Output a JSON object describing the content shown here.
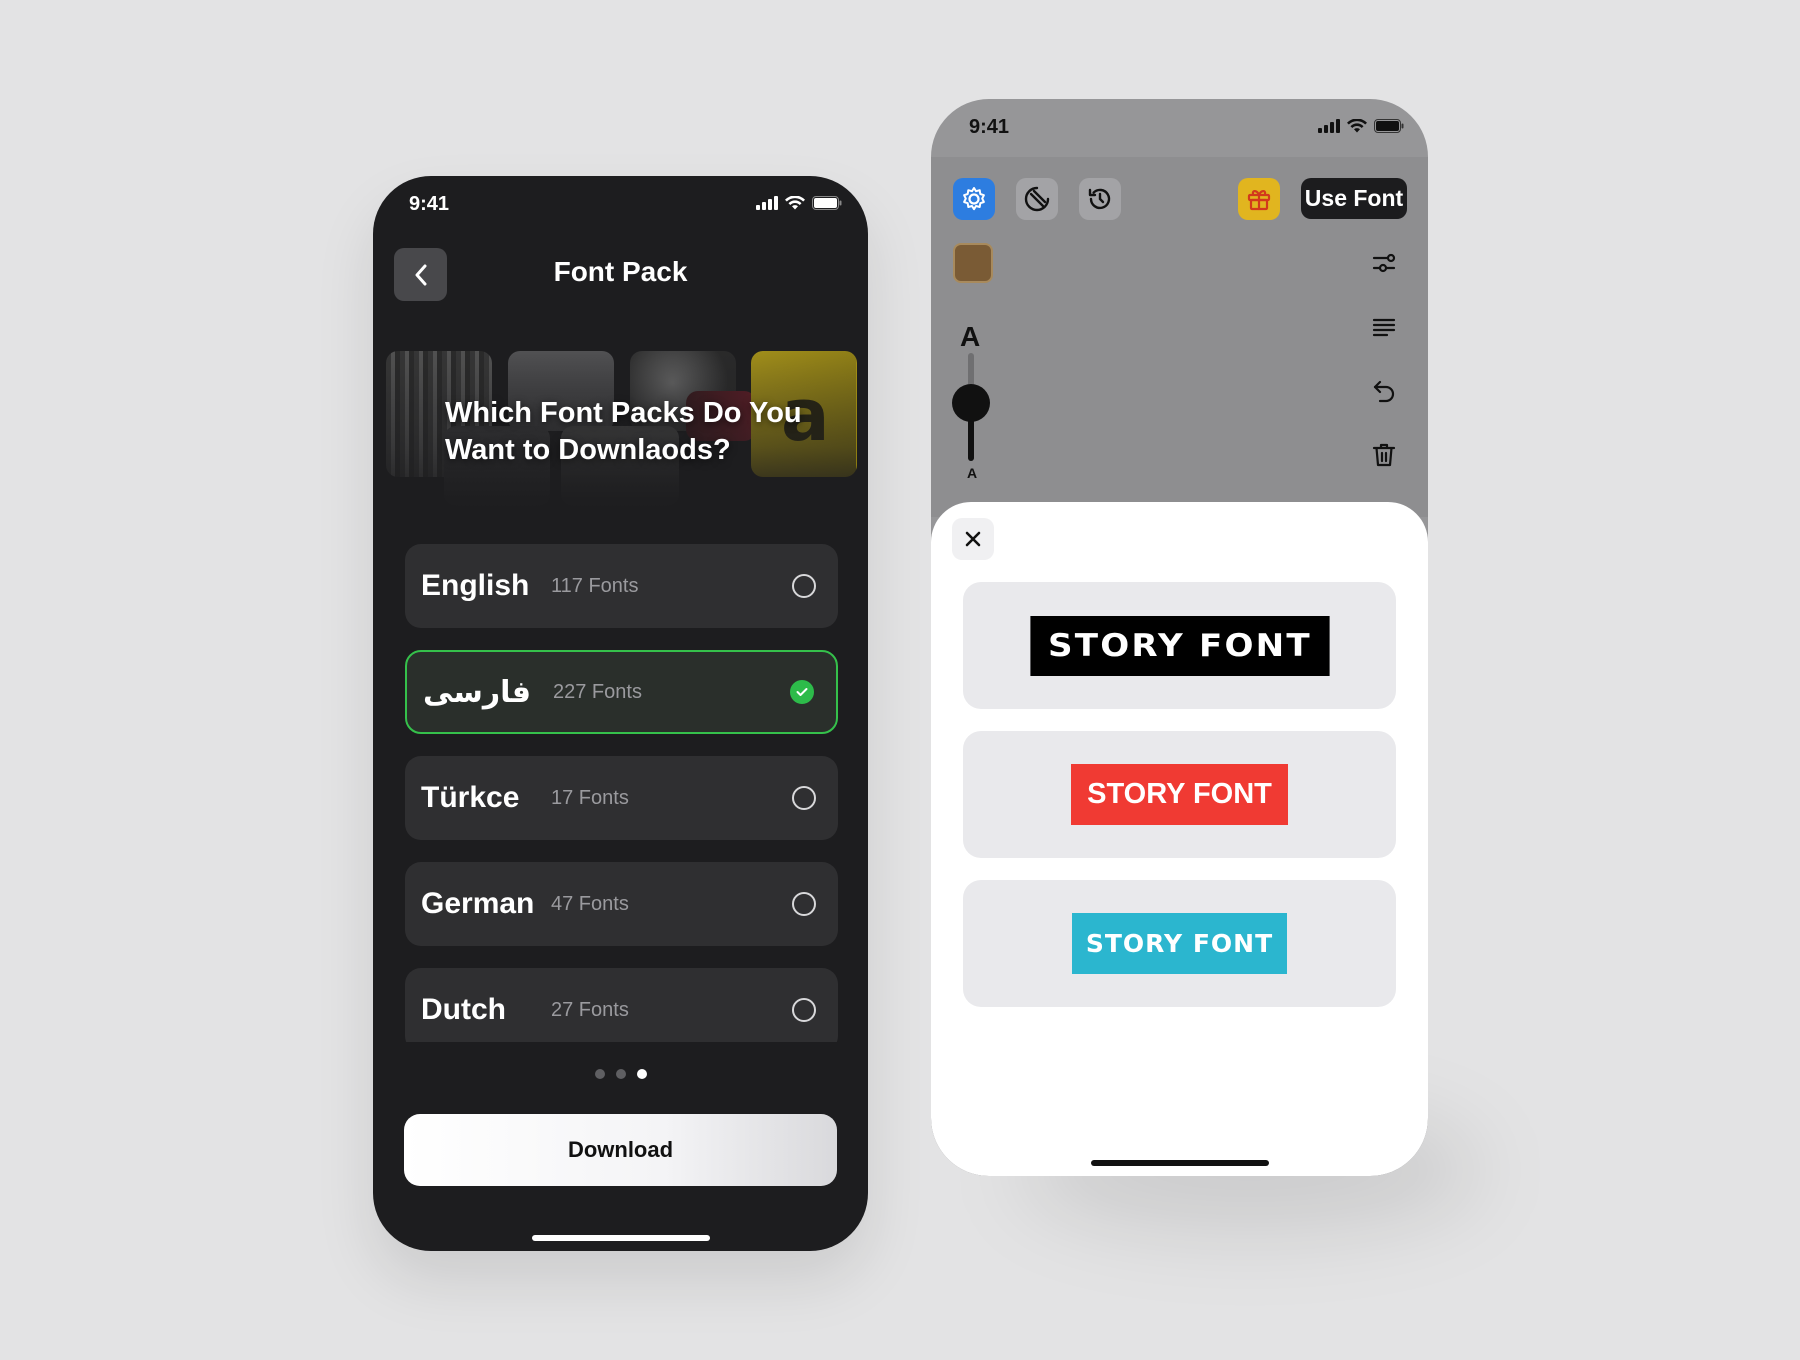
{
  "left_phone": {
    "status": {
      "time": "9:41"
    },
    "nav": {
      "title": "Font Pack"
    },
    "hero": {
      "title": "Which Font Packs Do You Want to Downlaods?",
      "thumb_letter": "a"
    },
    "languages": [
      {
        "name": "English",
        "count": "117 Fonts",
        "selected": false
      },
      {
        "name": "فارسی",
        "count": "227 Fonts",
        "selected": true
      },
      {
        "name": "Türkce",
        "count": "17 Fonts",
        "selected": false
      },
      {
        "name": "German",
        "count": "47 Fonts",
        "selected": false
      },
      {
        "name": "Dutch",
        "count": "27 Fonts",
        "selected": false
      }
    ],
    "pagination": {
      "total": 3,
      "active": 3
    },
    "download_label": "Download"
  },
  "right_phone": {
    "status": {
      "time": "9:41"
    },
    "toolbar": {
      "icons": [
        "settings-icon",
        "sticker-icon",
        "history-icon",
        "gift-icon"
      ],
      "use_font_label": "Use Font"
    },
    "text_size": {
      "large_label": "A",
      "small_label": "A"
    },
    "swatch_color": "#7a5b35",
    "side_tools": [
      "adjust-icon",
      "align-icon",
      "undo-icon",
      "trash-icon"
    ],
    "font_samples": [
      {
        "text": "STORY FONT",
        "bg": "#000000",
        "fg": "#ffffff"
      },
      {
        "text": "STORY FONT",
        "bg": "#f03a33",
        "fg": "#ffffff"
      },
      {
        "text": "STORY FONT",
        "bg": "#2bb6cf",
        "fg": "#ffffff"
      }
    ]
  },
  "colors": {
    "accent_green": "#35c14b",
    "accent_blue": "#2d7de0",
    "gift_gold": "#e1b51f"
  }
}
